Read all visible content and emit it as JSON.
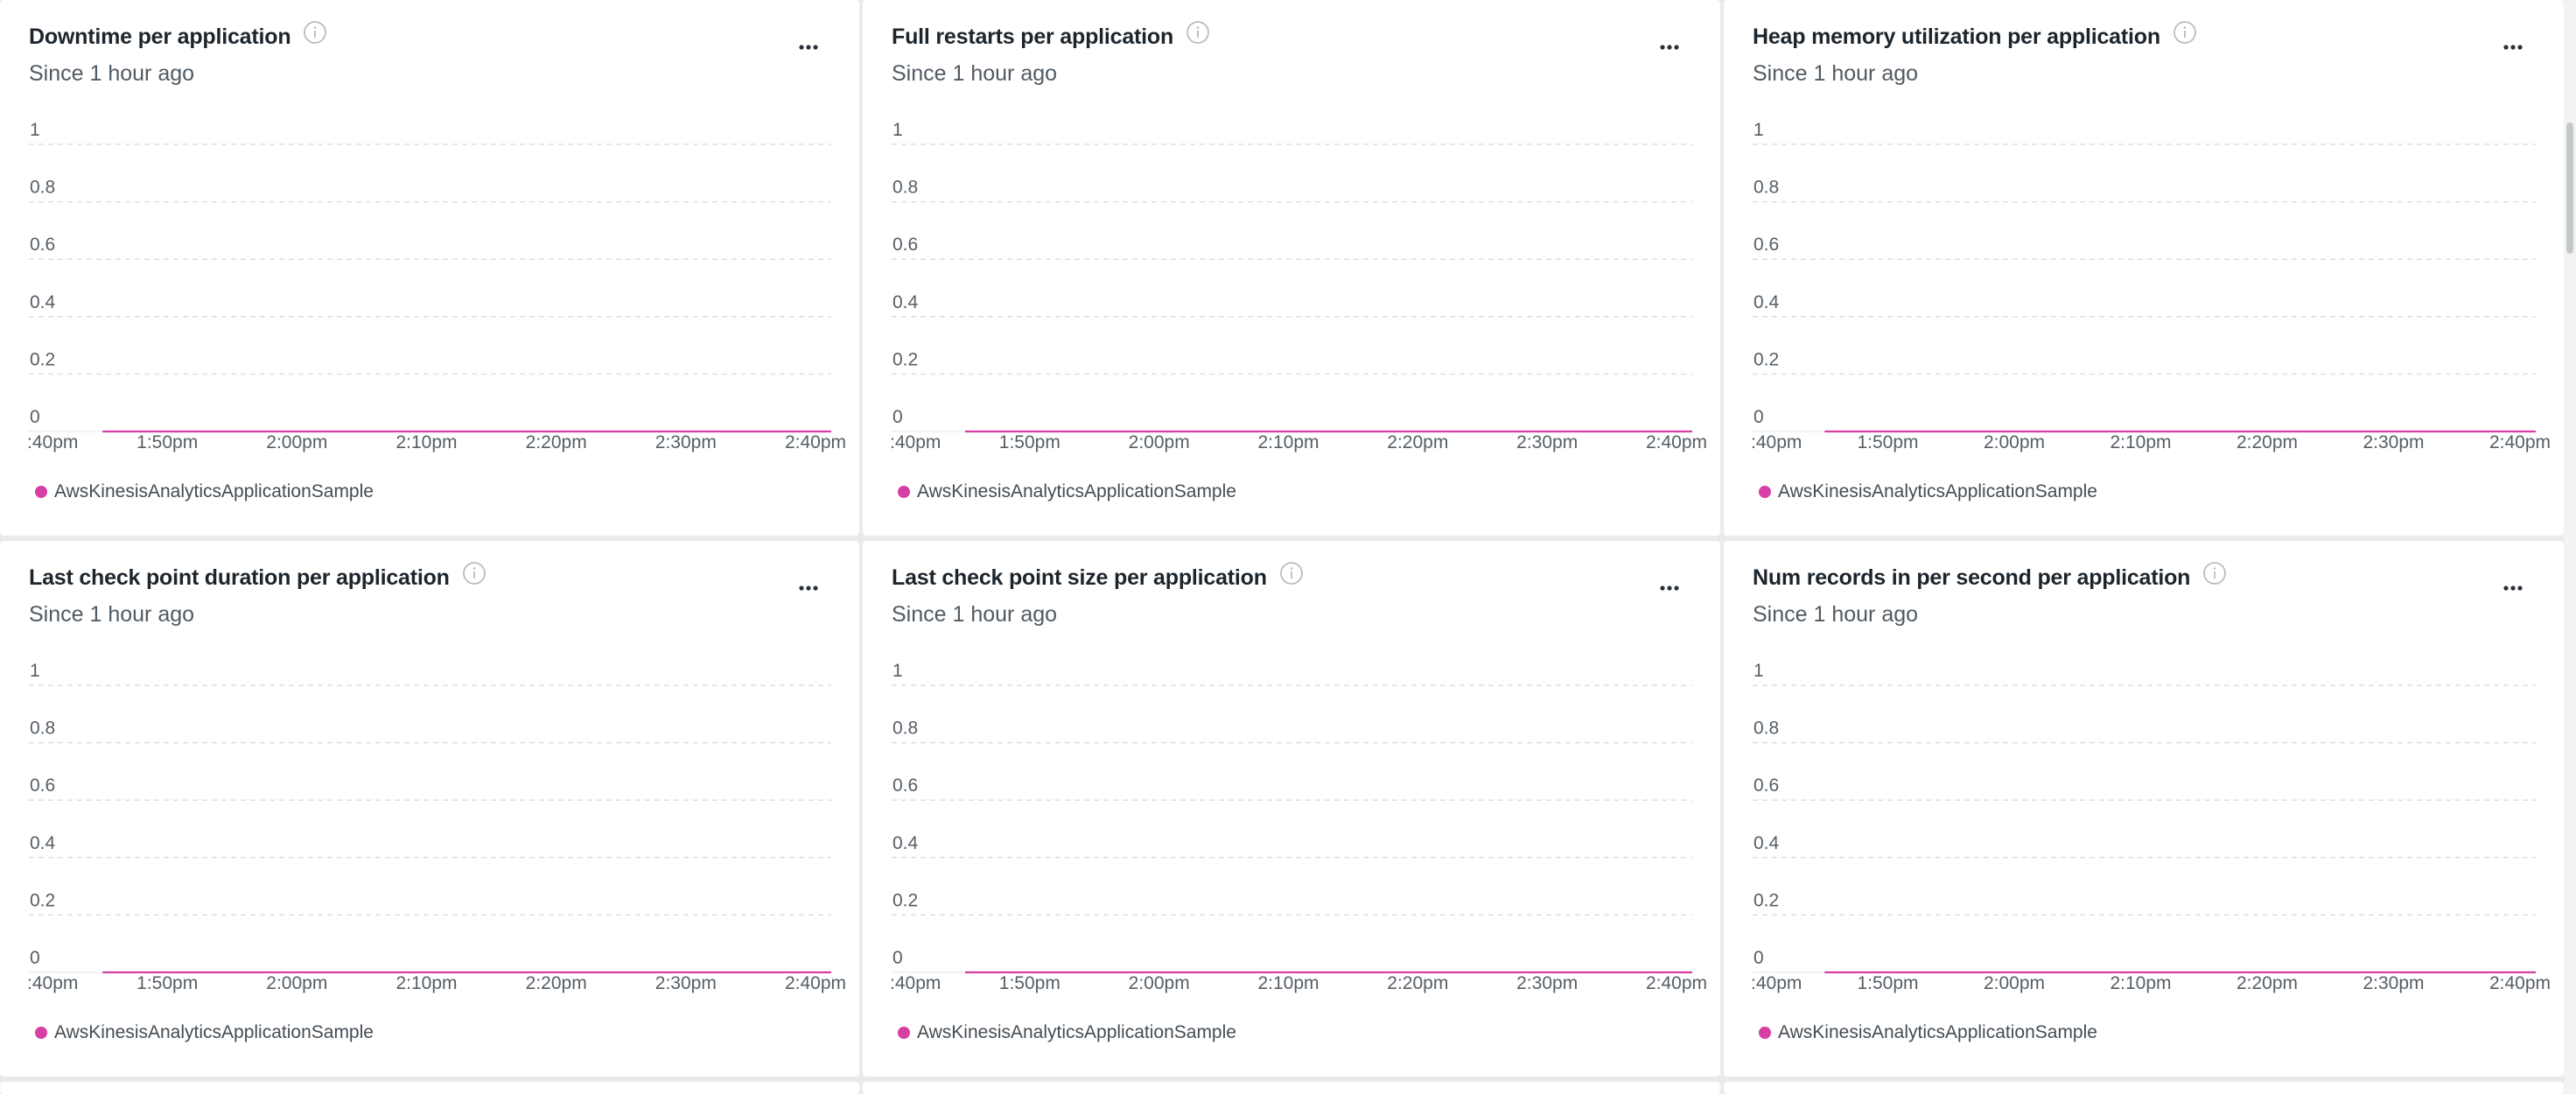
{
  "dashboard": {
    "cards": [
      {
        "title": "Downtime per application",
        "subtitle": "Since 1 hour ago",
        "legend": "AwsKinesisAnalyticsApplicationSample"
      },
      {
        "title": "Full restarts per application",
        "subtitle": "Since 1 hour ago",
        "legend": "AwsKinesisAnalyticsApplicationSample"
      },
      {
        "title": "Heap memory utilization per application",
        "subtitle": "Since 1 hour ago",
        "legend": "AwsKinesisAnalyticsApplicationSample"
      },
      {
        "title": "Last check point duration per application",
        "subtitle": "Since 1 hour ago",
        "legend": "AwsKinesisAnalyticsApplicationSample"
      },
      {
        "title": "Last check point size per application",
        "subtitle": "Since 1 hour ago",
        "legend": "AwsKinesisAnalyticsApplicationSample"
      },
      {
        "title": "Num records in per second per application",
        "subtitle": "Since 1 hour ago",
        "legend": "AwsKinesisAnalyticsApplicationSample"
      }
    ]
  },
  "colors": {
    "series": "#d63fa4",
    "grid": "#dcdfe1",
    "tick_text": "#555e66",
    "info_icon": "#b8bcc0"
  },
  "icons": {
    "info": "info-icon",
    "more": "more-options-icon"
  },
  "chart_data": [
    {
      "type": "line",
      "title": "Downtime per application",
      "subtitle": "Since 1 hour ago",
      "x_ticks": [
        ":40pm",
        "1:50pm",
        "2:00pm",
        "2:10pm",
        "2:20pm",
        "2:30pm",
        "2:40pm"
      ],
      "y_ticks": [
        "0",
        "0.2",
        "0.4",
        "0.6",
        "0.8",
        "1"
      ],
      "ylim": [
        0,
        1
      ],
      "grid": true,
      "legend_position": "bottom-left",
      "series": [
        {
          "name": "AwsKinesisAnalyticsApplicationSample",
          "x": [
            "1:45pm",
            "2:45pm"
          ],
          "y": [
            0,
            0
          ]
        }
      ]
    },
    {
      "type": "line",
      "title": "Full restarts per application",
      "subtitle": "Since 1 hour ago",
      "x_ticks": [
        ":40pm",
        "1:50pm",
        "2:00pm",
        "2:10pm",
        "2:20pm",
        "2:30pm",
        "2:40pm"
      ],
      "y_ticks": [
        "0",
        "0.2",
        "0.4",
        "0.6",
        "0.8",
        "1"
      ],
      "ylim": [
        0,
        1
      ],
      "grid": true,
      "legend_position": "bottom-left",
      "series": [
        {
          "name": "AwsKinesisAnalyticsApplicationSample",
          "x": [
            "1:45pm",
            "2:45pm"
          ],
          "y": [
            0,
            0
          ]
        }
      ]
    },
    {
      "type": "line",
      "title": "Heap memory utilization per application",
      "subtitle": "Since 1 hour ago",
      "x_ticks": [
        ":40pm",
        "1:50pm",
        "2:00pm",
        "2:10pm",
        "2:20pm",
        "2:30pm",
        "2:40pm"
      ],
      "y_ticks": [
        "0",
        "0.2",
        "0.4",
        "0.6",
        "0.8",
        "1"
      ],
      "ylim": [
        0,
        1
      ],
      "grid": true,
      "legend_position": "bottom-left",
      "series": [
        {
          "name": "AwsKinesisAnalyticsApplicationSample",
          "x": [
            "1:45pm",
            "2:45pm"
          ],
          "y": [
            0,
            0
          ]
        }
      ]
    },
    {
      "type": "line",
      "title": "Last check point duration per application",
      "subtitle": "Since 1 hour ago",
      "x_ticks": [
        ":40pm",
        "1:50pm",
        "2:00pm",
        "2:10pm",
        "2:20pm",
        "2:30pm",
        "2:40pm"
      ],
      "y_ticks": [
        "0",
        "0.2",
        "0.4",
        "0.6",
        "0.8",
        "1"
      ],
      "ylim": [
        0,
        1
      ],
      "grid": true,
      "legend_position": "bottom-left",
      "series": [
        {
          "name": "AwsKinesisAnalyticsApplicationSample",
          "x": [
            "1:45pm",
            "2:45pm"
          ],
          "y": [
            0,
            0
          ]
        }
      ]
    },
    {
      "type": "line",
      "title": "Last check point size per application",
      "subtitle": "Since 1 hour ago",
      "x_ticks": [
        ":40pm",
        "1:50pm",
        "2:00pm",
        "2:10pm",
        "2:20pm",
        "2:30pm",
        "2:40pm"
      ],
      "y_ticks": [
        "0",
        "0.2",
        "0.4",
        "0.6",
        "0.8",
        "1"
      ],
      "ylim": [
        0,
        1
      ],
      "grid": true,
      "legend_position": "bottom-left",
      "series": [
        {
          "name": "AwsKinesisAnalyticsApplicationSample",
          "x": [
            "1:45pm",
            "2:45pm"
          ],
          "y": [
            0,
            0
          ]
        }
      ]
    },
    {
      "type": "line",
      "title": "Num records in per second per application",
      "subtitle": "Since 1 hour ago",
      "x_ticks": [
        ":40pm",
        "1:50pm",
        "2:00pm",
        "2:10pm",
        "2:20pm",
        "2:30pm",
        "2:40pm"
      ],
      "y_ticks": [
        "0",
        "0.2",
        "0.4",
        "0.6",
        "0.8",
        "1"
      ],
      "ylim": [
        0,
        1
      ],
      "grid": true,
      "legend_position": "bottom-left",
      "series": [
        {
          "name": "AwsKinesisAnalyticsApplicationSample",
          "x": [
            "1:45pm",
            "2:45pm"
          ],
          "y": [
            0,
            0
          ]
        }
      ]
    }
  ]
}
